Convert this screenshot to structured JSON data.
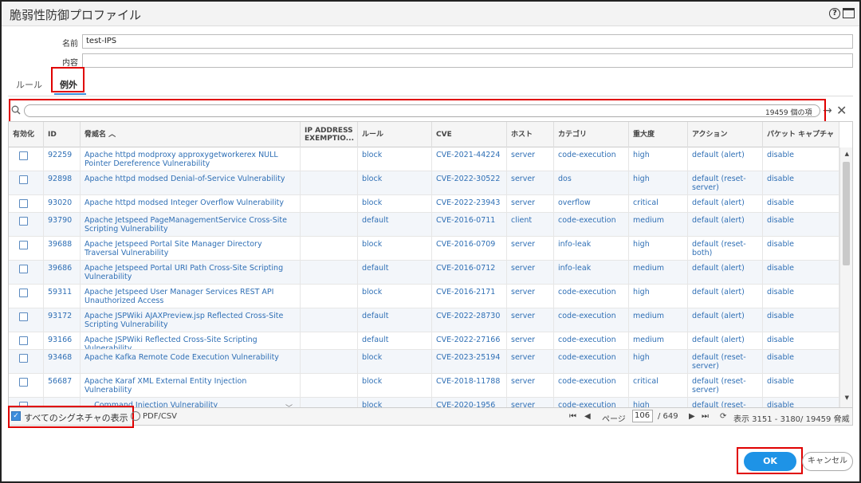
{
  "window": {
    "title": "脆弱性防御プロファイル",
    "help_icon": "?"
  },
  "form": {
    "name_label": "名前",
    "name_value": "test-IPS",
    "desc_label": "内容",
    "desc_value": ""
  },
  "tabs": [
    {
      "label": "ルール"
    },
    {
      "label": "例外"
    }
  ],
  "search": {
    "count_text": "19459 個の項",
    "placeholder": ""
  },
  "columns": [
    "有効化",
    "ID",
    "脅威名 ︿",
    "IP ADDRESS EXEMPTIO...",
    "ルール",
    "CVE",
    "ホスト",
    "カテゴリ",
    "重大度",
    "アクション",
    "パケット キャプチャ"
  ],
  "rows": [
    {
      "id": "92259",
      "name": "Apache httpd modproxy approxygetworkerex NULL Pointer Dereference Vulnerability",
      "rule": "block",
      "cve": "CVE-2021-44224",
      "host": "server",
      "category": "code-execution",
      "severity": "high",
      "action": "default (alert)",
      "capture": "disable"
    },
    {
      "id": "92898",
      "name": "Apache httpd modsed Denial-of-Service Vulnerability",
      "rule": "block",
      "cve": "CVE-2022-30522",
      "host": "server",
      "category": "dos",
      "severity": "high",
      "action": "default (reset-server)",
      "capture": "disable"
    },
    {
      "id": "93020",
      "name": "Apache httpd modsed Integer Overflow Vulnerability",
      "rule": "block",
      "cve": "CVE-2022-23943",
      "host": "server",
      "category": "overflow",
      "severity": "critical",
      "action": "default (alert)",
      "capture": "disable"
    },
    {
      "id": "93790",
      "name": "Apache Jetspeed PageManagementService Cross-Site Scripting Vulnerability",
      "rule": "default",
      "cve": "CVE-2016-0711",
      "host": "client",
      "category": "code-execution",
      "severity": "medium",
      "action": "default (alert)",
      "capture": "disable"
    },
    {
      "id": "39688",
      "name": "Apache Jetspeed Portal Site Manager Directory Traversal Vulnerability",
      "rule": "block",
      "cve": "CVE-2016-0709",
      "host": "server",
      "category": "info-leak",
      "severity": "high",
      "action": "default (reset-both)",
      "capture": "disable"
    },
    {
      "id": "39686",
      "name": "Apache Jetspeed Portal URI Path Cross-Site Scripting Vulnerability",
      "rule": "default",
      "cve": "CVE-2016-0712",
      "host": "server",
      "category": "info-leak",
      "severity": "medium",
      "action": "default (alert)",
      "capture": "disable"
    },
    {
      "id": "59311",
      "name": "Apache Jetspeed User Manager Services REST API Unauthorized Access",
      "rule": "block",
      "cve": "CVE-2016-2171",
      "host": "server",
      "category": "code-execution",
      "severity": "high",
      "action": "default (alert)",
      "capture": "disable"
    },
    {
      "id": "93172",
      "name": "Apache JSPWiki AJAXPreview.jsp Reflected Cross-Site Scripting Vulnerability",
      "rule": "default",
      "cve": "CVE-2022-28730",
      "host": "server",
      "category": "code-execution",
      "severity": "medium",
      "action": "default (alert)",
      "capture": "disable"
    },
    {
      "id": "93166",
      "name": "Apache JSPWiki Reflected Cross-Site Scripting Vulnerability",
      "rule": "default",
      "cve": "CVE-2022-27166",
      "host": "server",
      "category": "code-execution",
      "severity": "medium",
      "action": "default (alert)",
      "capture": "disable"
    },
    {
      "id": "93468",
      "name": "Apache Kafka Remote Code Execution Vulnerability",
      "rule": "block",
      "cve": "CVE-2023-25194",
      "host": "server",
      "category": "code-execution",
      "severity": "high",
      "action": "default (reset-server)",
      "capture": "disable"
    },
    {
      "id": "56687",
      "name": "Apache Karaf XML External Entity Injection Vulnerability",
      "rule": "block",
      "cve": "CVE-2018-11788",
      "host": "server",
      "category": "code-execution",
      "severity": "critical",
      "action": "default (reset-server)",
      "capture": "disable"
    },
    {
      "id": "",
      "name": "... Command Injection Vulnerability",
      "rule": "block",
      "cve": "CVE-2020-1956",
      "host": "server",
      "category": "code-execution",
      "severity": "high",
      "action": "default (reset-",
      "capture": "disable"
    }
  ],
  "footer": {
    "show_all_label": "すべてのシグネチャの表示",
    "pdf_label": "PDF/CSV",
    "page_label": "ページ",
    "page_value": "106",
    "page_total": "/ 649",
    "display_text": "表示 3151 - 3180/ 19459 脅威"
  },
  "buttons": {
    "ok": "OK",
    "cancel": "キャンセル"
  }
}
